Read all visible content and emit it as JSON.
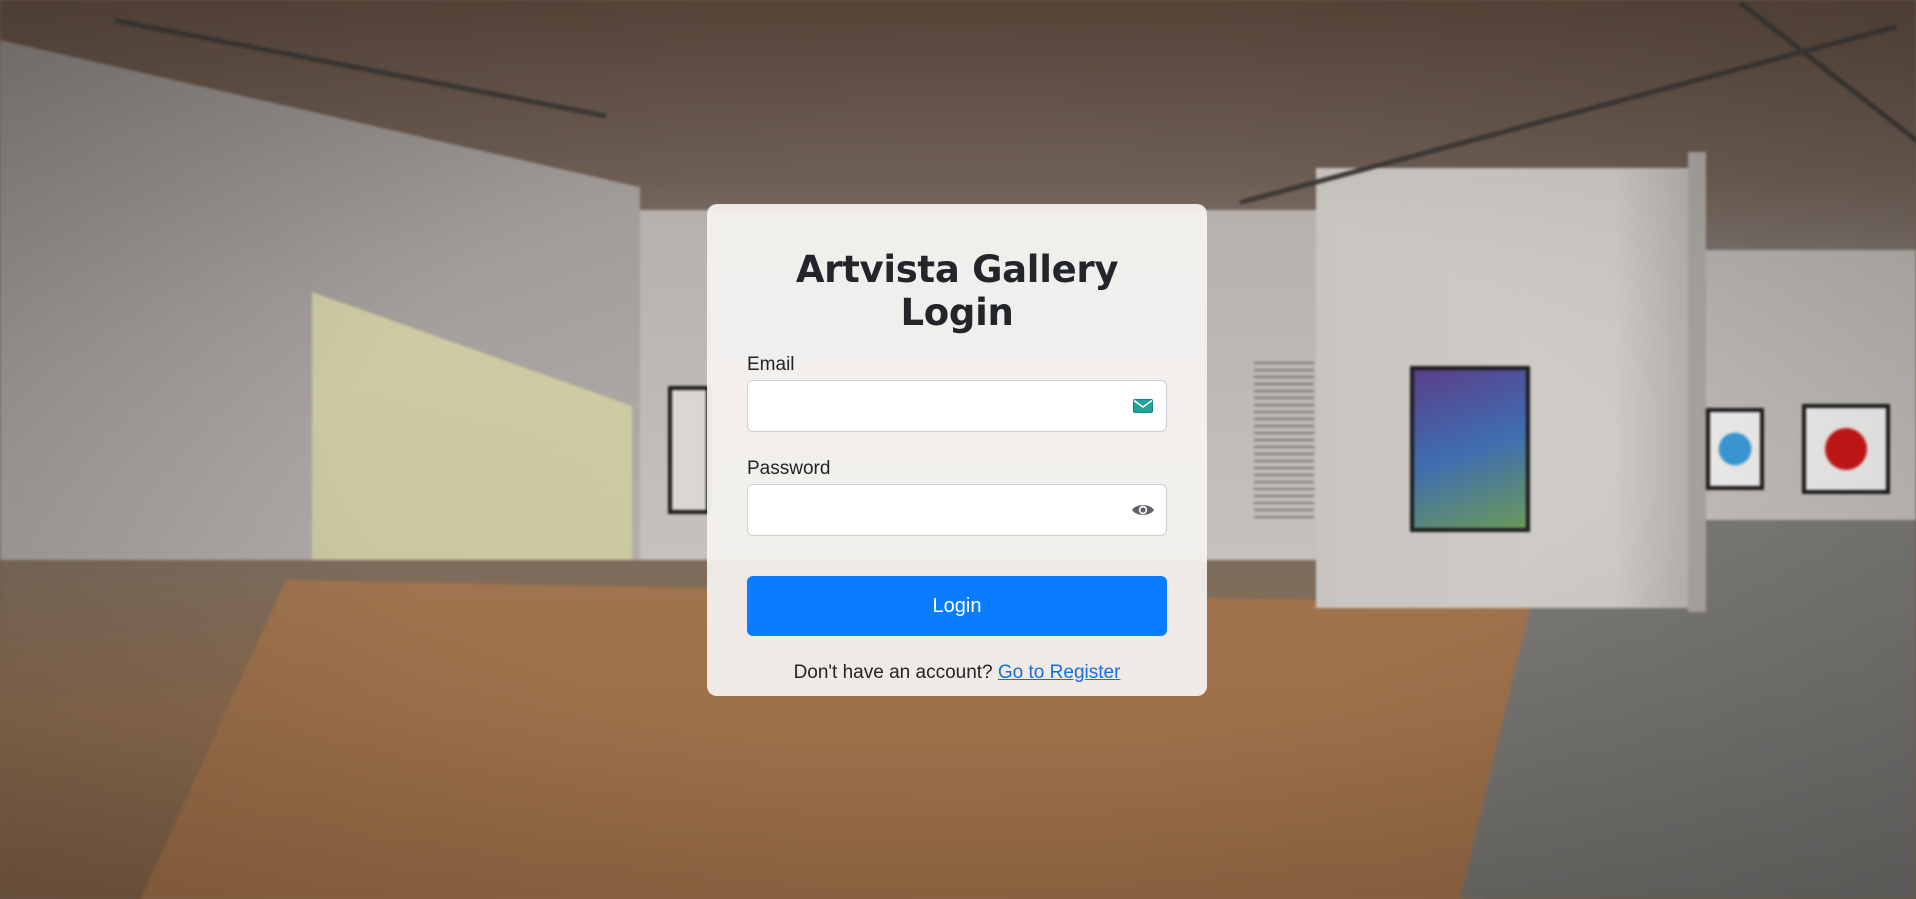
{
  "page": {
    "title": "Artvista Gallery Login"
  },
  "form": {
    "email_label": "Email",
    "email_value": "",
    "email_icon": "envelope-icon",
    "password_label": "Password",
    "password_value": "",
    "password_icon": "eye-icon",
    "submit_label": "Login"
  },
  "footer": {
    "prompt": "Don't have an account?",
    "register_link": "Go to Register"
  },
  "colors": {
    "primary_button": "#0a7cff",
    "link": "#1a6ed8",
    "card_background": "#f5f3f1"
  }
}
